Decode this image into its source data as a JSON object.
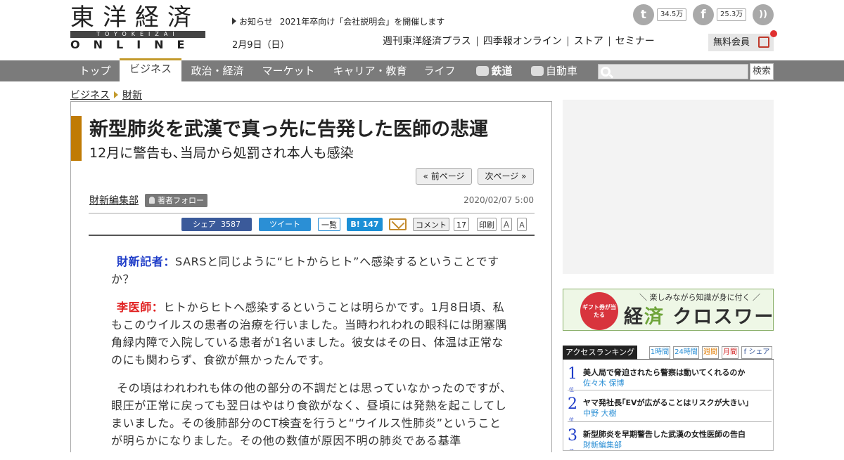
{
  "header": {
    "logo_kanji": "東洋経済",
    "logo_roman": "TOYOKEIZAI",
    "logo_online": "ONLINE",
    "notice_label": "お知らせ",
    "notice_text": "2021年卒向け「会社説明会」を開催します",
    "date": "2月9日（日）",
    "top_links": [
      "週刊東洋経済プラス",
      "四季報オンライン",
      "ストア",
      "セミナー"
    ],
    "twitter_count": "34.5万",
    "facebook_count": "25.3万",
    "member_label": "無料会員"
  },
  "nav": {
    "items": [
      "トップ",
      "ビジネス",
      "政治・経済",
      "マーケット",
      "キャリア・教育",
      "ライフ",
      "鉄道",
      "自動車"
    ],
    "search_button": "検索"
  },
  "breadcrumb": [
    "ビジネス",
    "財新"
  ],
  "article": {
    "title": "新型肺炎を武漢で真っ先に告発した医師の悲運",
    "subtitle": "12月に警告も､当局から処罰され本人も感染",
    "prev_page": "« 前ページ",
    "next_page": "次ページ »",
    "author": "財新編集部",
    "follow": "著者フォロー",
    "published": "2020/02/07 5:00",
    "share": {
      "facebook": "シェア",
      "facebook_count": "3587",
      "tweet": "ツイート",
      "ichiran": "一覧",
      "hatena": "147",
      "comment": "コメント",
      "comment_count": "17",
      "print": "印刷",
      "font_large": "A",
      "font_small": "A"
    },
    "paragraphs": [
      {
        "speaker": "財新記者：",
        "speaker_color": "#1e3cc8",
        "text": "SARSと同じように“ヒトからヒト”へ感染するということですか？"
      },
      {
        "speaker": "李医師：",
        "speaker_color": "#e02020",
        "text": "ヒトからヒトへ感染するということは明らかです。1月8日頃、私もこのウイルスの患者の治療を行いました。当時われわれの眼科には閉塞隅角緑内障で入院している患者が1名いました。彼女はその日、体温は正常なのにも関わらず、食欲が無かったんです。"
      },
      {
        "speaker": "",
        "speaker_color": "",
        "text": "その頃はわれわれも体の他の部分の不調だとは思っていなかったのですが、眼圧が正常に戻っても翌日はやはり食欲がなく、昼頃には発熱を起こしてしまいました。その後肺部分のCT検査を行うと“ウイルス性肺炎”ということが明らかになりました。その他の数値が原因不明の肺炎である基準"
      }
    ]
  },
  "sidebar": {
    "banner_ring": "ギフト券が当たる",
    "banner_small": "＼ 楽しみながら知識が身に付く ／",
    "banner_big_1": "経",
    "banner_big_2": "済",
    "banner_big_3": " クロスワード",
    "ranking_title": "アクセスランキング",
    "ranking_tabs": [
      "1時間",
      "24時間",
      "週間",
      "月間",
      "シェア"
    ],
    "ranking": [
      {
        "rank": "1",
        "unit": "位",
        "headline": "美人局で脅迫されたら警察は動いてくれるのか",
        "author": "佐々木 保博"
      },
      {
        "rank": "2",
        "unit": "位",
        "headline": "ヤマ発社長｢EVが広がることはリスクが大きい｣",
        "author": "中野 大樹"
      },
      {
        "rank": "3",
        "unit": "位",
        "headline": "新型肺炎を早期警告した武漢の女性医師の告白",
        "author": "財新編集部"
      }
    ]
  }
}
